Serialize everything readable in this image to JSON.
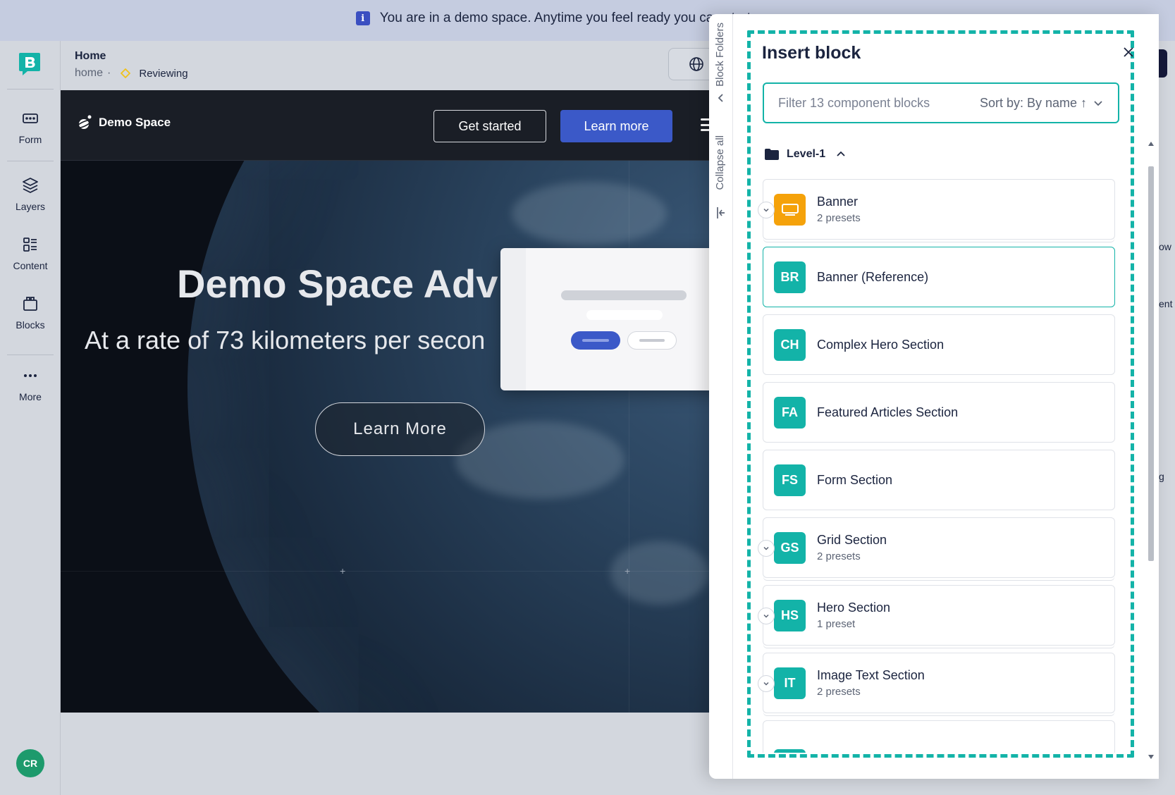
{
  "banner": {
    "info_icon": "i",
    "text": "You are in a demo space. Anytime you feel ready you can start your own s"
  },
  "rail": {
    "items": [
      {
        "label": "Form",
        "icon": "form-icon"
      },
      {
        "label": "Layers",
        "icon": "layers-icon"
      },
      {
        "label": "Content",
        "icon": "content-icon"
      },
      {
        "label": "Blocks",
        "icon": "blocks-icon"
      },
      {
        "label": "More",
        "icon": "more-icon"
      }
    ],
    "avatar_initials": "CR"
  },
  "header": {
    "title": "Home",
    "path": "home",
    "separator": "·",
    "status": "Reviewing"
  },
  "preview": {
    "brand": "Demo Space",
    "get_started": "Get started",
    "learn_more": "Learn more",
    "hero_title": "Demo Space Adv",
    "hero_subtitle": "At a rate of 73 kilometers per secon",
    "hero_cta": "Learn More"
  },
  "drawer": {
    "folders_label": "Block Folders",
    "collapse_label": "Collapse all",
    "title": "Insert block",
    "filter_placeholder": "Filter 13 component blocks",
    "sort_label": "Sort by: By name ↑",
    "folder_name": "Level-1",
    "blocks": [
      {
        "badge": "",
        "name": "Banner",
        "presets": "2 presets"
      },
      {
        "badge": "BR",
        "name": "Banner (Reference)",
        "presets": ""
      },
      {
        "badge": "CH",
        "name": "Complex Hero Section",
        "presets": ""
      },
      {
        "badge": "FA",
        "name": "Featured Articles Section",
        "presets": ""
      },
      {
        "badge": "FS",
        "name": "Form Section",
        "presets": ""
      },
      {
        "badge": "GS",
        "name": "Grid Section",
        "presets": "2 presets"
      },
      {
        "badge": "HS",
        "name": "Hero Section",
        "presets": "1 preset"
      },
      {
        "badge": "IT",
        "name": "Image Text Section",
        "presets": "2 presets"
      }
    ]
  },
  "right_edge": {
    "fragments": [
      "ow",
      "ent",
      "g"
    ]
  },
  "colors": {
    "accent": "#13b3a8",
    "primary": "#3b59c8",
    "banner_orange": "#f5a20a",
    "status_diamond": "#f0c21b",
    "avatar": "#1d9a6c"
  }
}
